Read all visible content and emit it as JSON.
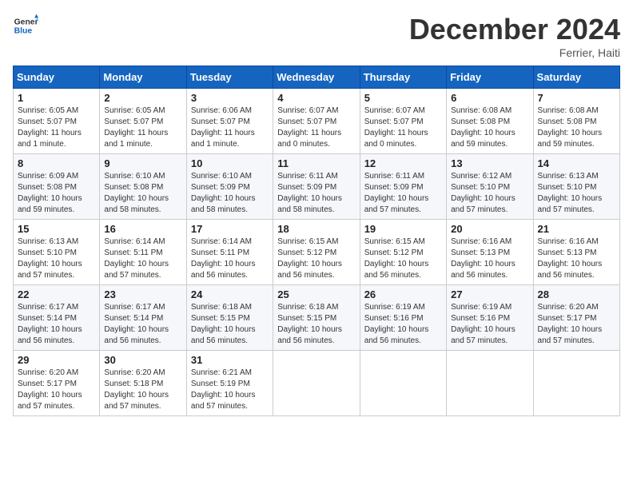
{
  "header": {
    "logo_general": "General",
    "logo_blue": "Blue",
    "month_title": "December 2024",
    "location": "Ferrier, Haiti"
  },
  "weekdays": [
    "Sunday",
    "Monday",
    "Tuesday",
    "Wednesday",
    "Thursday",
    "Friday",
    "Saturday"
  ],
  "weeks": [
    [
      {
        "day": "1",
        "sunrise": "Sunrise: 6:05 AM",
        "sunset": "Sunset: 5:07 PM",
        "daylight": "Daylight: 11 hours and 1 minute."
      },
      {
        "day": "2",
        "sunrise": "Sunrise: 6:05 AM",
        "sunset": "Sunset: 5:07 PM",
        "daylight": "Daylight: 11 hours and 1 minute."
      },
      {
        "day": "3",
        "sunrise": "Sunrise: 6:06 AM",
        "sunset": "Sunset: 5:07 PM",
        "daylight": "Daylight: 11 hours and 1 minute."
      },
      {
        "day": "4",
        "sunrise": "Sunrise: 6:07 AM",
        "sunset": "Sunset: 5:07 PM",
        "daylight": "Daylight: 11 hours and 0 minutes."
      },
      {
        "day": "5",
        "sunrise": "Sunrise: 6:07 AM",
        "sunset": "Sunset: 5:07 PM",
        "daylight": "Daylight: 11 hours and 0 minutes."
      },
      {
        "day": "6",
        "sunrise": "Sunrise: 6:08 AM",
        "sunset": "Sunset: 5:08 PM",
        "daylight": "Daylight: 10 hours and 59 minutes."
      },
      {
        "day": "7",
        "sunrise": "Sunrise: 6:08 AM",
        "sunset": "Sunset: 5:08 PM",
        "daylight": "Daylight: 10 hours and 59 minutes."
      }
    ],
    [
      {
        "day": "8",
        "sunrise": "Sunrise: 6:09 AM",
        "sunset": "Sunset: 5:08 PM",
        "daylight": "Daylight: 10 hours and 59 minutes."
      },
      {
        "day": "9",
        "sunrise": "Sunrise: 6:10 AM",
        "sunset": "Sunset: 5:08 PM",
        "daylight": "Daylight: 10 hours and 58 minutes."
      },
      {
        "day": "10",
        "sunrise": "Sunrise: 6:10 AM",
        "sunset": "Sunset: 5:09 PM",
        "daylight": "Daylight: 10 hours and 58 minutes."
      },
      {
        "day": "11",
        "sunrise": "Sunrise: 6:11 AM",
        "sunset": "Sunset: 5:09 PM",
        "daylight": "Daylight: 10 hours and 58 minutes."
      },
      {
        "day": "12",
        "sunrise": "Sunrise: 6:11 AM",
        "sunset": "Sunset: 5:09 PM",
        "daylight": "Daylight: 10 hours and 57 minutes."
      },
      {
        "day": "13",
        "sunrise": "Sunrise: 6:12 AM",
        "sunset": "Sunset: 5:10 PM",
        "daylight": "Daylight: 10 hours and 57 minutes."
      },
      {
        "day": "14",
        "sunrise": "Sunrise: 6:13 AM",
        "sunset": "Sunset: 5:10 PM",
        "daylight": "Daylight: 10 hours and 57 minutes."
      }
    ],
    [
      {
        "day": "15",
        "sunrise": "Sunrise: 6:13 AM",
        "sunset": "Sunset: 5:10 PM",
        "daylight": "Daylight: 10 hours and 57 minutes."
      },
      {
        "day": "16",
        "sunrise": "Sunrise: 6:14 AM",
        "sunset": "Sunset: 5:11 PM",
        "daylight": "Daylight: 10 hours and 57 minutes."
      },
      {
        "day": "17",
        "sunrise": "Sunrise: 6:14 AM",
        "sunset": "Sunset: 5:11 PM",
        "daylight": "Daylight: 10 hours and 56 minutes."
      },
      {
        "day": "18",
        "sunrise": "Sunrise: 6:15 AM",
        "sunset": "Sunset: 5:12 PM",
        "daylight": "Daylight: 10 hours and 56 minutes."
      },
      {
        "day": "19",
        "sunrise": "Sunrise: 6:15 AM",
        "sunset": "Sunset: 5:12 PM",
        "daylight": "Daylight: 10 hours and 56 minutes."
      },
      {
        "day": "20",
        "sunrise": "Sunrise: 6:16 AM",
        "sunset": "Sunset: 5:13 PM",
        "daylight": "Daylight: 10 hours and 56 minutes."
      },
      {
        "day": "21",
        "sunrise": "Sunrise: 6:16 AM",
        "sunset": "Sunset: 5:13 PM",
        "daylight": "Daylight: 10 hours and 56 minutes."
      }
    ],
    [
      {
        "day": "22",
        "sunrise": "Sunrise: 6:17 AM",
        "sunset": "Sunset: 5:14 PM",
        "daylight": "Daylight: 10 hours and 56 minutes."
      },
      {
        "day": "23",
        "sunrise": "Sunrise: 6:17 AM",
        "sunset": "Sunset: 5:14 PM",
        "daylight": "Daylight: 10 hours and 56 minutes."
      },
      {
        "day": "24",
        "sunrise": "Sunrise: 6:18 AM",
        "sunset": "Sunset: 5:15 PM",
        "daylight": "Daylight: 10 hours and 56 minutes."
      },
      {
        "day": "25",
        "sunrise": "Sunrise: 6:18 AM",
        "sunset": "Sunset: 5:15 PM",
        "daylight": "Daylight: 10 hours and 56 minutes."
      },
      {
        "day": "26",
        "sunrise": "Sunrise: 6:19 AM",
        "sunset": "Sunset: 5:16 PM",
        "daylight": "Daylight: 10 hours and 56 minutes."
      },
      {
        "day": "27",
        "sunrise": "Sunrise: 6:19 AM",
        "sunset": "Sunset: 5:16 PM",
        "daylight": "Daylight: 10 hours and 57 minutes."
      },
      {
        "day": "28",
        "sunrise": "Sunrise: 6:20 AM",
        "sunset": "Sunset: 5:17 PM",
        "daylight": "Daylight: 10 hours and 57 minutes."
      }
    ],
    [
      {
        "day": "29",
        "sunrise": "Sunrise: 6:20 AM",
        "sunset": "Sunset: 5:17 PM",
        "daylight": "Daylight: 10 hours and 57 minutes."
      },
      {
        "day": "30",
        "sunrise": "Sunrise: 6:20 AM",
        "sunset": "Sunset: 5:18 PM",
        "daylight": "Daylight: 10 hours and 57 minutes."
      },
      {
        "day": "31",
        "sunrise": "Sunrise: 6:21 AM",
        "sunset": "Sunset: 5:19 PM",
        "daylight": "Daylight: 10 hours and 57 minutes."
      },
      null,
      null,
      null,
      null
    ]
  ]
}
